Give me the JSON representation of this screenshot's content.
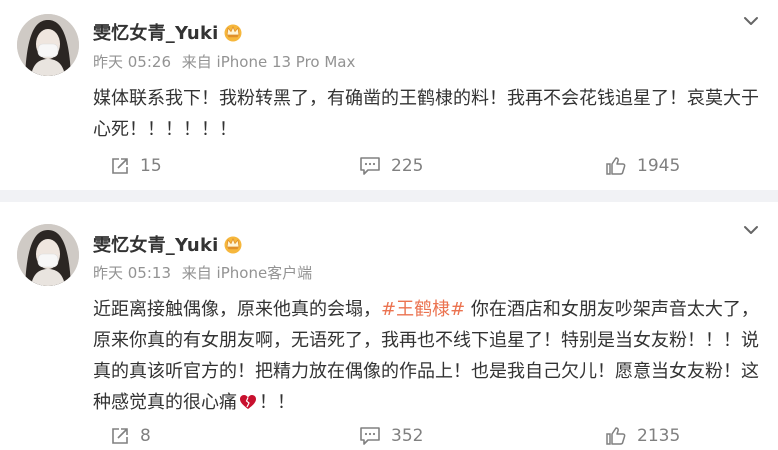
{
  "colors": {
    "topic": "#eb7350",
    "muted": "#939393",
    "text": "#333333"
  },
  "posts": [
    {
      "username": "雯忆女青_Yuki",
      "badge_icon": "crown-badge-icon",
      "time": "昨天 05:26",
      "source": "来自 iPhone 13 Pro Max",
      "text_before": "媒体联系我下！我粉转黑了，有确凿的王鹤棣的料！我再不会花钱追星了！哀莫大于心死！！！！！！",
      "topic": "",
      "text_after": "",
      "text_end": "",
      "forwards": "15",
      "comments": "225",
      "likes": "1945"
    },
    {
      "username": "雯忆女青_Yuki",
      "badge_icon": "crown-badge-icon",
      "time": "昨天 05:13",
      "source": "来自 iPhone客户端",
      "text_before": "近距离接触偶像，原来他真的会塌，",
      "topic": "#王鹤棣#",
      "text_after": " 你在酒店和女朋友吵架声音太大了，原来你真的有女朋友啊，无语死了，我再也不线下追星了！特别是当女友粉！！！说真的真该听官方的！把精力放在偶像的作品上！也是我自己欠儿！愿意当女友粉！这种感觉真的很心痛",
      "text_end": "！！",
      "forwards": "8",
      "comments": "352",
      "likes": "2135"
    }
  ]
}
